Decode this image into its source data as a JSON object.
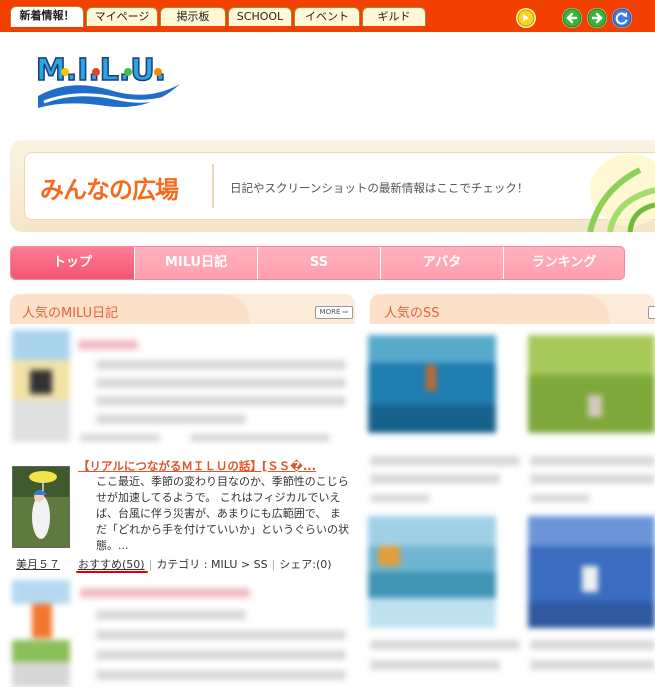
{
  "top_tabs": [
    {
      "label": "新着情報！",
      "active": true
    },
    {
      "label": "マイページ",
      "active": false
    },
    {
      "label": "掲示板",
      "active": false
    },
    {
      "label": "SCHOOL",
      "active": false
    },
    {
      "label": "イベント",
      "active": false
    },
    {
      "label": "ギルド",
      "active": false
    }
  ],
  "logo_text": "M.I.L.U.",
  "banner": {
    "title": "みんなの広場",
    "subtitle": "日記やスクリーンショットの最新情報はここでチェック！"
  },
  "nav": [
    {
      "label": "トップ",
      "active": true
    },
    {
      "label": "MILU日記",
      "active": false
    },
    {
      "label": "SS",
      "active": false
    },
    {
      "label": "アバタ",
      "active": false
    },
    {
      "label": "ランキング",
      "active": false
    }
  ],
  "left_section": {
    "title": "人気のMILU日記",
    "more_label": "MORE"
  },
  "right_section": {
    "title": "人気のSS"
  },
  "entry": {
    "title": "【リアルにつながるＭＩＬＵの話】[ＳＳ�...",
    "body": [
      "ここ最近、季節の変わり目なのか、季節性のこじら",
      "せが加速してるようで。 これはフィジカルでいえ",
      "ば、台風に伴う災害が、あまりにも広範囲で、 ま",
      "だ「どれから手を付けていいか」というぐらいの状",
      "態。..."
    ],
    "author": "美月５７",
    "recommend": "おすすめ(50)",
    "category": "カテゴリ : MILU > SS",
    "share": "シェア:(0)"
  },
  "colors": {
    "topbar": "#f14000",
    "accent_orange": "#f46a1f",
    "nav_pink": "#ff9fb0",
    "highlight_red": "#e00000"
  },
  "icons": [
    "arrow-sticker-icon",
    "back-arrow-icon",
    "forward-arrow-icon",
    "refresh-icon"
  ]
}
